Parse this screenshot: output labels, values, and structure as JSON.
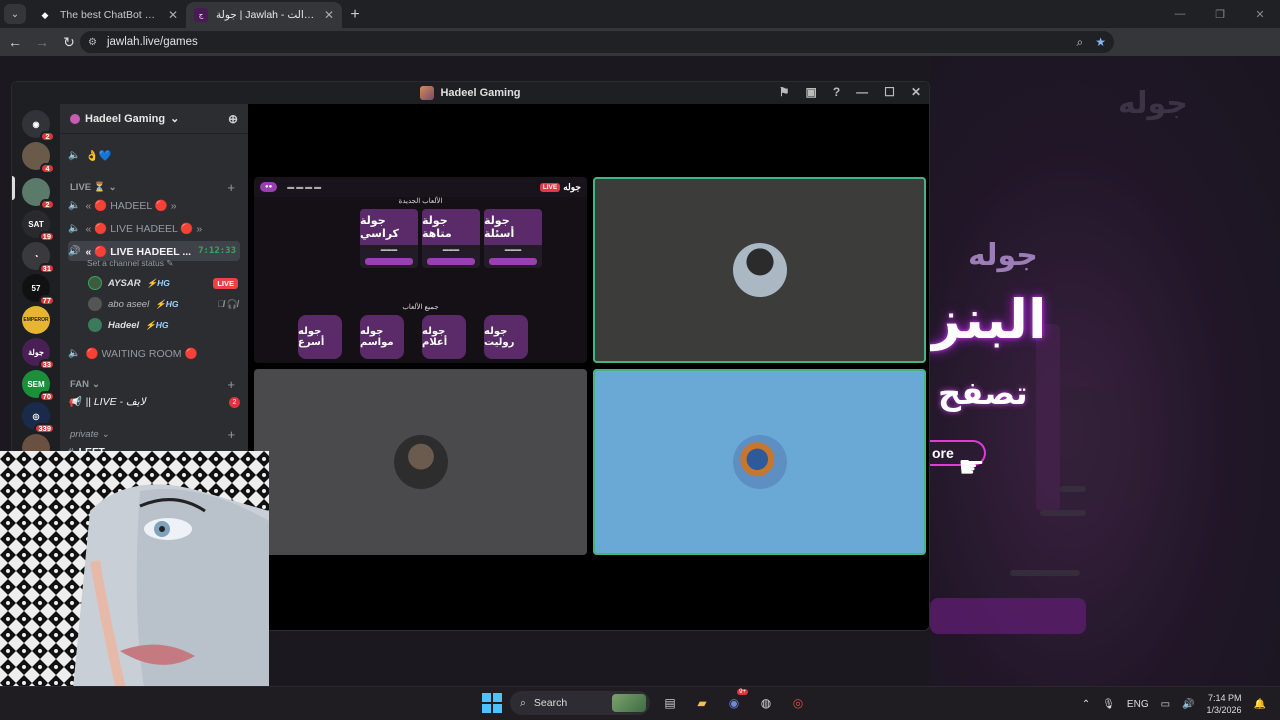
{
  "browser": {
    "tabs": [
      {
        "title": "The best ChatBot and Widgets",
        "active": false
      },
      {
        "title": "جولة | Jawlah - منصة الألعاب الت...",
        "active": true
      }
    ],
    "url": "jawlah.live/games",
    "icons": {
      "back": "back-arrow-icon",
      "forward": "forward-arrow-icon",
      "reload": "reload-icon"
    }
  },
  "page": {
    "logo_small": "جوله",
    "hero_logo": "جوله",
    "hero_title": "البنز",
    "hero_sub": "تصفح",
    "hero_button": "ore"
  },
  "discord": {
    "window_title": "Hadeel Gaming",
    "server_name": "Hadeel Gaming",
    "server_badges": {
      "home": "2",
      "s1": "4",
      "s2": "2",
      "s3": "19",
      "s4": "31",
      "s5": "77",
      "s7": "33",
      "s8": "70",
      "s9": "339"
    },
    "server_labels": {
      "sat": "SAT",
      "emperor": "EMPEROR",
      "jawla": "جولة",
      "sem": "SEM"
    },
    "top_reactions": "👌💙",
    "cat_live": "LIVE ⏳",
    "vc1": "« 🔴 HADEEL 🔴 »",
    "vc2": "« 🔴 LIVE HADEEL 🔴 »",
    "vc3": "« 🔴 LIVE HADEEL ...",
    "vc3_timer": "7:12:33",
    "status_hint": "Set a channel status ✎",
    "members": [
      {
        "name": "AYSAR",
        "tag": "⚡HG",
        "badge": "LIVE"
      },
      {
        "name": "abo aseel",
        "tag": "⚡HG",
        "badge": ""
      },
      {
        "name": "Hadeel",
        "tag": "⚡HG",
        "badge": ""
      }
    ],
    "vc_waiting": "🔴 WAITING ROOM 🔴",
    "cat_fan": "FAN",
    "fan_channel": "|| LIVE - لايف",
    "fan_badge": "2",
    "cat_private": "private",
    "left_channel": "LEFT"
  },
  "share": {
    "logo": "جوله",
    "live": "LIVE",
    "new_games": "الألعاب الجديدة",
    "all_games": "جميع الألعاب",
    "cards": [
      "جولة كراسي",
      "جولة متاهة",
      "جولة أسئلة"
    ],
    "rounds": [
      "جوله أسرع",
      "جوله مواسم",
      "جوله أعلام",
      "جوله رولیت"
    ]
  },
  "taskbar": {
    "search": "Search",
    "discord_badge": "9+",
    "lang": "ENG",
    "time": "7:14 PM",
    "date": "1/3/2026"
  }
}
